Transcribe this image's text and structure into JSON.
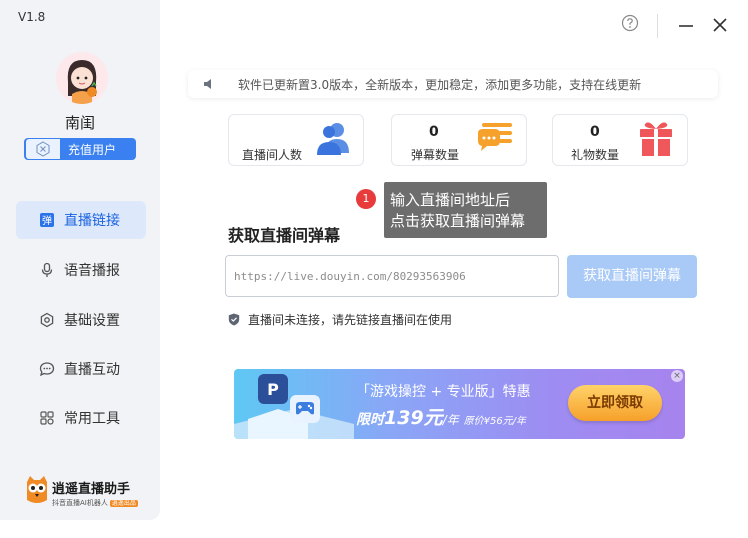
{
  "app": {
    "version": "V1.8"
  },
  "user": {
    "name": "南闺",
    "badge_label": "充值用户"
  },
  "sidebar": {
    "items": [
      {
        "label": "直播链接",
        "icon": "barrage-icon",
        "active": true
      },
      {
        "label": "语音播报",
        "icon": "microphone-icon",
        "active": false
      },
      {
        "label": "基础设置",
        "icon": "settings-icon",
        "active": false
      },
      {
        "label": "直播互动",
        "icon": "chat-icon",
        "active": false
      },
      {
        "label": "常用工具",
        "icon": "grid-icon",
        "active": false
      }
    ]
  },
  "logo": {
    "title": "逍遥直播助手",
    "subtitle": "抖音直播AI机器人",
    "tag": "逍遥出品"
  },
  "notice": {
    "text": "软件已更新置3.0版本，全新版本，更加稳定，添加更多功能，支持在线更新"
  },
  "stats": {
    "room_count_label": "直播间人数",
    "barrage": {
      "value": "0",
      "label": "弹幕数量"
    },
    "gifts": {
      "value": "0",
      "label": "礼物数量"
    }
  },
  "tooltip": {
    "step": "1",
    "line1": "输入直播间地址后",
    "line2": "点击获取直播间弹幕"
  },
  "main": {
    "section_title": "获取直播间弹幕",
    "url_placeholder": "https://live.douyin.com/80293563906",
    "fetch_label": "获取直播间弹幕",
    "status_text": "直播间未连接，请先链接直播间在使用"
  },
  "banner": {
    "title": "「游戏操控 + 专业版」特惠",
    "limited": "限时",
    "price": "139元",
    "unit": "/年",
    "original": "原价¥56元/年",
    "cta": "立即领取",
    "close": "×"
  },
  "colors": {
    "accent": "#1a64e0",
    "fetch_button": "#a9c9f7",
    "sidebar_bg": "#f1f3f6"
  }
}
